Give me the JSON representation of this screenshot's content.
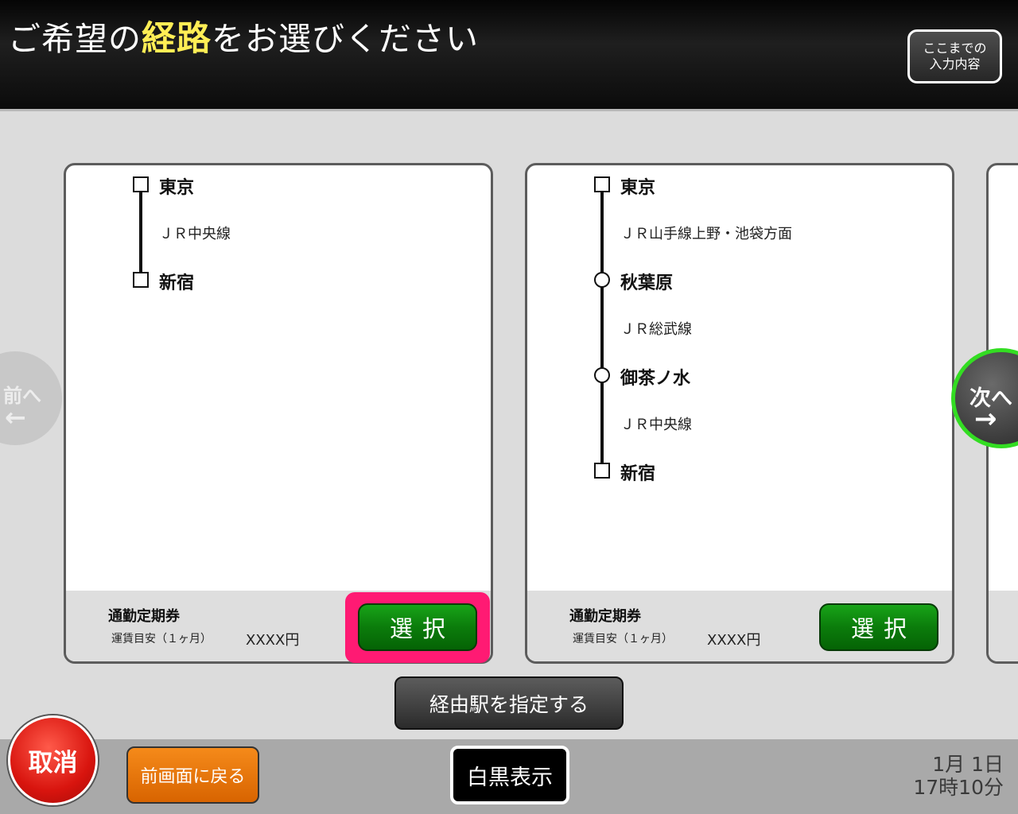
{
  "header": {
    "title_pre": "ご希望の",
    "title_highlight": "経路",
    "title_post": "をお選びください",
    "summary_button": [
      "ここまでの",
      "入力内容"
    ]
  },
  "routes": [
    {
      "stations": [
        "東京",
        "新宿"
      ],
      "lines": [
        "ＪＲ中央線"
      ],
      "pass_type": "通勤定期券",
      "fare_label": "運賃目安（１ヶ月）",
      "fare_value": "XXXX円",
      "select_label": "選択"
    },
    {
      "stations": [
        "東京",
        "秋葉原",
        "御茶ノ水",
        "新宿"
      ],
      "lines": [
        "ＪＲ山手線上野・池袋方面",
        "ＪＲ総武線",
        "ＪＲ中央線"
      ],
      "pass_type": "通勤定期券",
      "fare_label": "運賃目安（１ヶ月）",
      "fare_value": "XXXX円",
      "select_label": "選択"
    }
  ],
  "nav": {
    "prev_label": "前へ",
    "prev_arrow": "←",
    "next_label": "次へ",
    "next_arrow": "→"
  },
  "via_button": "経由駅を指定する",
  "bottom": {
    "cancel": "取消",
    "back": "前画面に戻る",
    "monochrome": "白黒表示",
    "date": "1月 1日",
    "time": "17時10分"
  },
  "colors": {
    "highlight": "#ffee55",
    "select_green": "#0b7c0b",
    "focus_pink": "#ff1a73",
    "next_ring": "#33dd22",
    "cancel_red": "#d8140e",
    "back_orange": "#f58a1a"
  }
}
